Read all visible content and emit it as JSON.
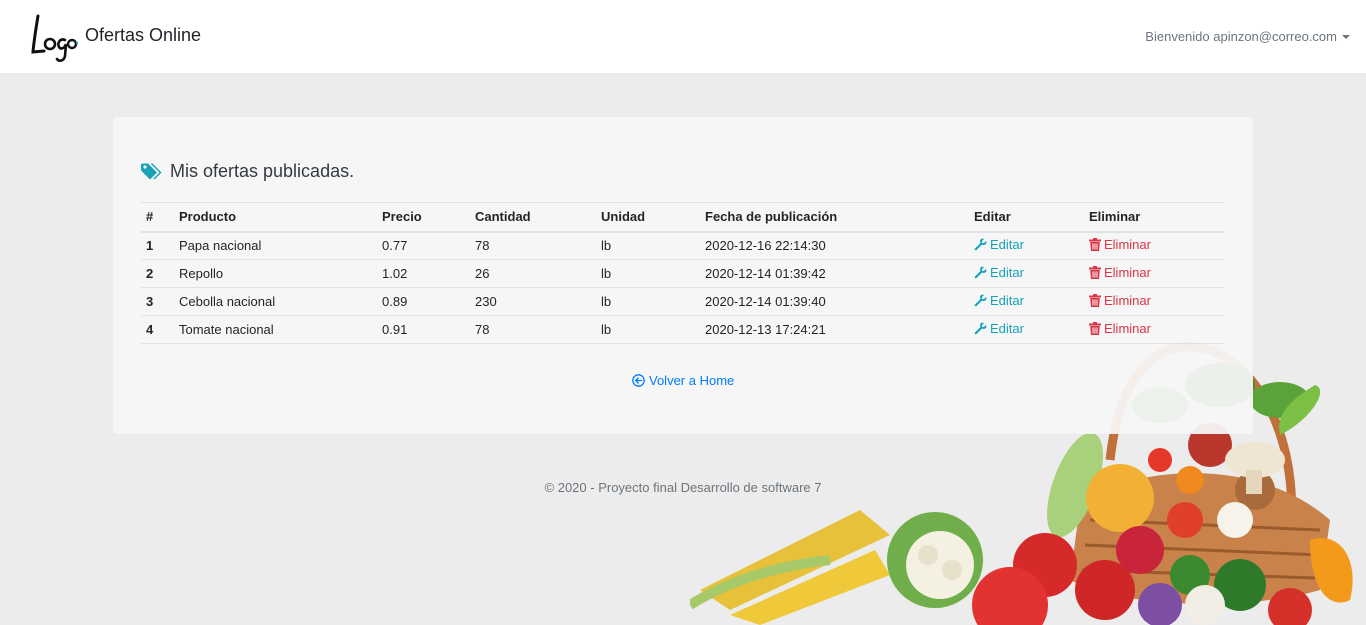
{
  "navbar": {
    "logo_text": "Logo",
    "brand": "Ofertas Online",
    "user_menu": "Bienvenido apinzon@correo.com"
  },
  "card": {
    "title": "Mis ofertas publicadas.",
    "icon": "tags-icon"
  },
  "table": {
    "headers": [
      "#",
      "Producto",
      "Precio",
      "Cantidad",
      "Unidad",
      "Fecha de publicación",
      "Editar",
      "Eliminar"
    ],
    "rows": [
      {
        "index": "1",
        "product": "Papa nacional",
        "price": "0.77",
        "quantity": "78",
        "unit": "lb",
        "date": "2020-12-16 22:14:30",
        "edit": "Editar",
        "delete": "Eliminar"
      },
      {
        "index": "2",
        "product": "Repollo",
        "price": "1.02",
        "quantity": "26",
        "unit": "lb",
        "date": "2020-12-14 01:39:42",
        "edit": "Editar",
        "delete": "Eliminar"
      },
      {
        "index": "3",
        "product": "Cebolla nacional",
        "price": "0.89",
        "quantity": "230",
        "unit": "lb",
        "date": "2020-12-14 01:39:40",
        "edit": "Editar",
        "delete": "Eliminar"
      },
      {
        "index": "4",
        "product": "Tomate nacional",
        "price": "0.91",
        "quantity": "78",
        "unit": "lb",
        "date": "2020-12-13 17:24:21",
        "edit": "Editar",
        "delete": "Eliminar"
      }
    ]
  },
  "back_link": "Volver a Home",
  "footer": "© 2020 - Proyecto final Desarrollo de software 7",
  "colors": {
    "edit": "#17a2b8",
    "delete": "#dc3545",
    "link": "#007bff",
    "title_icon": "#17a2b8"
  }
}
